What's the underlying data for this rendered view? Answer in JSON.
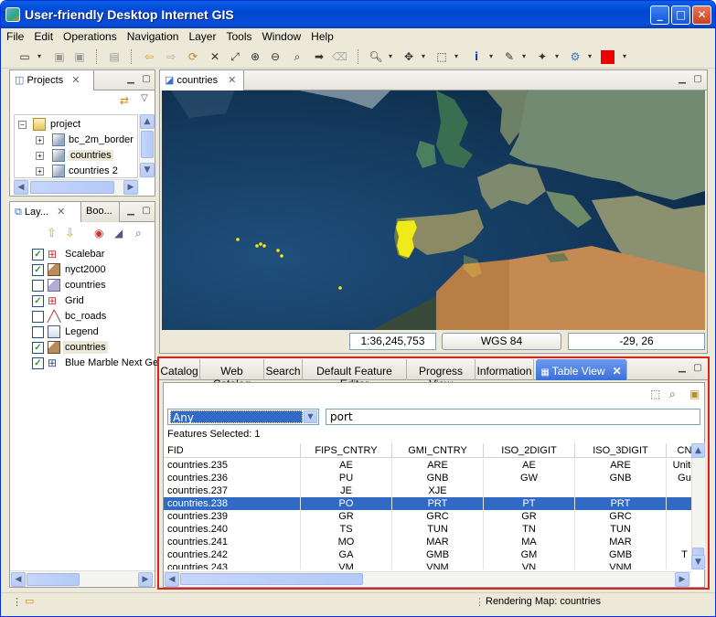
{
  "window": {
    "title": "User-friendly Desktop Internet GIS",
    "buttons": [
      "_",
      "□",
      "✕"
    ]
  },
  "menu": [
    "File",
    "Edit",
    "Operations",
    "Navigation",
    "Layer",
    "Tools",
    "Window",
    "Help"
  ],
  "projects": {
    "tab": "Projects",
    "root": "project",
    "items": [
      "bc_2m_border",
      "countries",
      "countries 2"
    ]
  },
  "layers": {
    "tabs": [
      "Lay...",
      "Boo..."
    ],
    "items": [
      {
        "label": "Scalebar",
        "checked": true
      },
      {
        "label": "nyct2000",
        "checked": true
      },
      {
        "label": "countries",
        "checked": false
      },
      {
        "label": "Grid",
        "checked": true
      },
      {
        "label": "bc_roads",
        "checked": false
      },
      {
        "label": "Legend",
        "checked": false
      },
      {
        "label": "countries",
        "checked": true
      },
      {
        "label": "Blue Marble Next Ge",
        "checked": true
      }
    ]
  },
  "mapview": {
    "tab": "countries",
    "scale": "1:36,245,753",
    "crs": "WGS 84",
    "coords": "-29, 26"
  },
  "bottom": {
    "tabs": [
      "Catalog",
      "Web Catalog",
      "Search",
      "Default Feature Editor",
      "Progress View",
      "Information",
      "Table View"
    ],
    "active": "Table View"
  },
  "table": {
    "filter": "Any",
    "search": "port",
    "features_selected": "Features Selected: 1",
    "columns": [
      "FID",
      "FIPS_CNTRY",
      "GMI_CNTRY",
      "ISO_2DIGIT",
      "ISO_3DIGIT",
      "CN"
    ],
    "rows": [
      [
        "countries.235",
        "AE",
        "ARE",
        "AE",
        "ARE",
        "Unite"
      ],
      [
        "countries.236",
        "PU",
        "GNB",
        "GW",
        "GNB",
        "Gu"
      ],
      [
        "countries.237",
        "JE",
        "XJE",
        "",
        "",
        ""
      ],
      [
        "countries.238",
        "PO",
        "PRT",
        "PT",
        "PRT",
        ""
      ],
      [
        "countries.239",
        "GR",
        "GRC",
        "GR",
        "GRC",
        ""
      ],
      [
        "countries.240",
        "TS",
        "TUN",
        "TN",
        "TUN",
        ""
      ],
      [
        "countries.241",
        "MO",
        "MAR",
        "MA",
        "MAR",
        ""
      ],
      [
        "countries.242",
        "GA",
        "GMB",
        "GM",
        "GMB",
        "T"
      ],
      [
        "countries.243",
        "VM",
        "VNM",
        "VN",
        "VNM",
        ""
      ]
    ],
    "selected_row": 3
  },
  "status": {
    "text": "Rendering Map: countries"
  }
}
